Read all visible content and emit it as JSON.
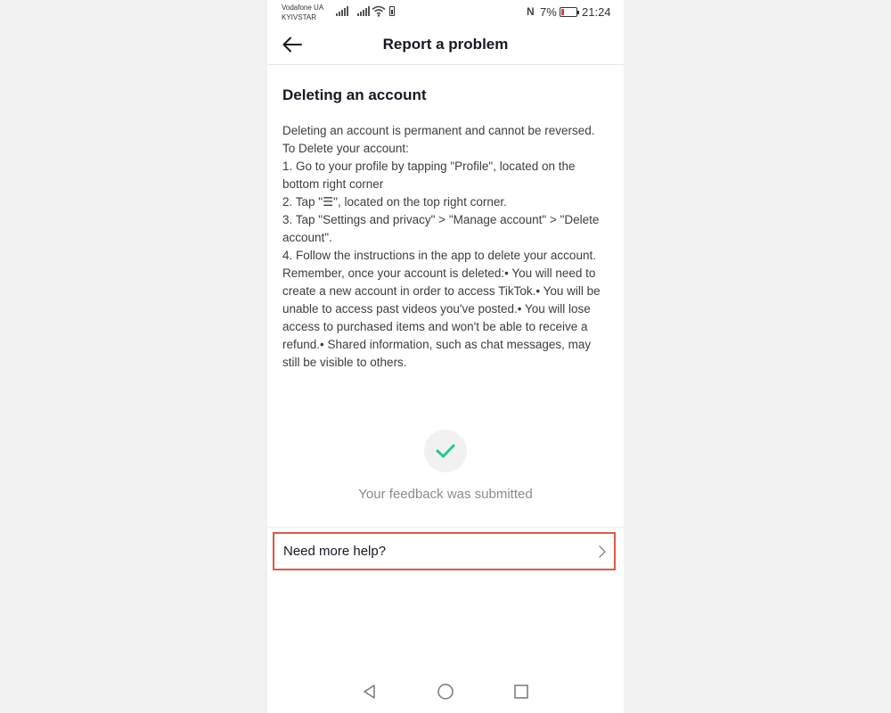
{
  "status_bar": {
    "carrier_1": "Vodafone UA",
    "carrier_2": "KYIVSTAR",
    "battery_percent": "7%",
    "time": "21:24"
  },
  "header": {
    "title": "Report a problem"
  },
  "article": {
    "title": "Deleting an account",
    "body": "Deleting an account is permanent and cannot be reversed.\nTo Delete your account:\n1. Go to your profile by tapping \"Profile\", located on the bottom right corner\n2. Tap \"☰\", located on the top right corner.\n3. Tap \"Settings and privacy\" > \"Manage account\" > \"Delete account\".\n4. Follow the instructions in the app to delete your account.\nRemember, once your account is deleted:• You will need to create a new account in order to access TikTok.• You will be unable to access past videos you've posted.• You will lose access to purchased items and won't be able to receive a refund.• Shared information, such as chat messages, may still be visible to others."
  },
  "feedback": {
    "message": "Your feedback was submitted",
    "accent_color": "#20c997"
  },
  "help": {
    "label": "Need more help?",
    "highlight_color": "#e0574a"
  },
  "icons": {
    "back": "arrow-left-icon",
    "check": "checkmark-icon",
    "chevron": "chevron-right-icon",
    "nav_back": "triangle-back-icon",
    "nav_home": "circle-home-icon",
    "nav_recents": "square-recents-icon"
  }
}
